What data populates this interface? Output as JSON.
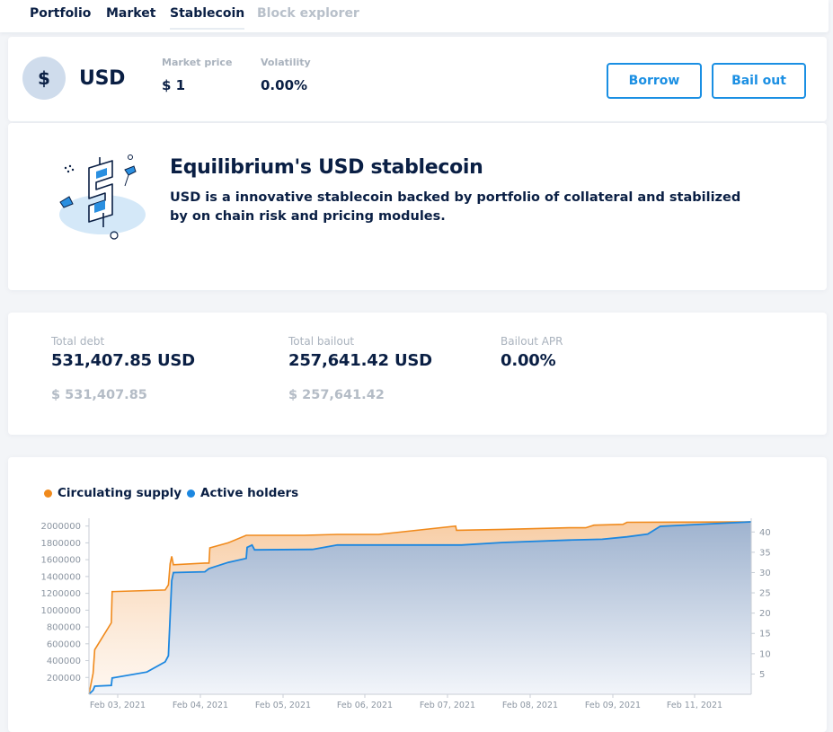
{
  "nav": {
    "tabs": [
      {
        "label": "Portfolio"
      },
      {
        "label": "Market"
      },
      {
        "label": "Stablecoin"
      },
      {
        "label": "Block explorer"
      }
    ]
  },
  "header": {
    "coin_symbol": "$",
    "coin_name": "USD",
    "market_price_label": "Market price",
    "market_price_value": "$ 1",
    "volatility_label": "Volatility",
    "volatility_value": "0.00%",
    "borrow_label": "Borrow",
    "bailout_label": "Bail out"
  },
  "intro": {
    "title": "Equilibrium's USD stablecoin",
    "text": "USD is a innovative stablecoin backed by portfolio of collateral and stabilized by on chain risk and pricing modules."
  },
  "stats": {
    "total_debt_label": "Total debt",
    "total_debt_value": "531,407.85 USD",
    "total_debt_usd": "$ 531,407.85",
    "total_bailout_label": "Total bailout",
    "total_bailout_value": "257,641.42 USD",
    "total_bailout_usd": "$ 257,641.42",
    "bailout_apr_label": "Bailout APR",
    "bailout_apr_value": "0.00%"
  },
  "colors": {
    "accent": "#1a8fe3",
    "supply": "#f08a1c",
    "holders": "#1c87e0"
  },
  "chart_data": {
    "type": "area",
    "legend": [
      "Circulating supply",
      "Active holders"
    ],
    "x_ticks": [
      "Feb 03, 2021",
      "Feb 04, 2021",
      "Feb 05, 2021",
      "Feb 06, 2021",
      "Feb 07, 2021",
      "Feb 08, 2021",
      "Feb 09, 2021",
      "Feb 11, 2021"
    ],
    "y_left_ticks": [
      200000,
      400000,
      600000,
      800000,
      1000000,
      1200000,
      1400000,
      1600000,
      1800000,
      2000000
    ],
    "y_left_ticks_text": [
      "200000",
      "400000",
      "600000",
      "800000",
      "1000000",
      "1200000",
      "1400000",
      "1600000",
      "1800000",
      "2000000"
    ],
    "y_right_ticks": [
      5,
      10,
      15,
      20,
      25,
      30,
      35,
      40
    ],
    "y_right_ticks_text": [
      "5",
      "10",
      "15",
      "20",
      "25",
      "30",
      "35",
      "40"
    ],
    "ylim_left": [
      0,
      2050000
    ],
    "ylim_right": [
      0,
      42.5
    ],
    "xlim": [
      0,
      8
    ],
    "series": [
      {
        "name": "Circulating supply",
        "axis": "left",
        "points": [
          [
            0,
            0
          ],
          [
            0.05,
            250000
          ],
          [
            0.07,
            530000
          ],
          [
            0.27,
            850000
          ],
          [
            0.28,
            1220000
          ],
          [
            0.92,
            1240000
          ],
          [
            0.96,
            1300000
          ],
          [
            0.98,
            1550000
          ],
          [
            1.0,
            1640000
          ],
          [
            1.02,
            1540000
          ],
          [
            1.4,
            1560000
          ],
          [
            1.45,
            1560000
          ],
          [
            1.46,
            1740000
          ],
          [
            1.68,
            1800000
          ],
          [
            1.9,
            1890000
          ],
          [
            2.6,
            1890000
          ],
          [
            3.0,
            1900000
          ],
          [
            3.5,
            1900000
          ],
          [
            4.43,
            2000000
          ],
          [
            4.44,
            1950000
          ],
          [
            5.0,
            1960000
          ],
          [
            5.8,
            1980000
          ],
          [
            6.0,
            1980000
          ],
          [
            6.1,
            2010000
          ],
          [
            6.45,
            2020000
          ],
          [
            6.5,
            2045000
          ],
          [
            8.0,
            2050000
          ]
        ]
      },
      {
        "name": "Active holders",
        "axis": "right",
        "points": [
          [
            0,
            0
          ],
          [
            0.05,
            1
          ],
          [
            0.07,
            2
          ],
          [
            0.27,
            2.2
          ],
          [
            0.28,
            4
          ],
          [
            0.7,
            5.5
          ],
          [
            0.92,
            8
          ],
          [
            0.96,
            9.5
          ],
          [
            1.0,
            28
          ],
          [
            1.02,
            30
          ],
          [
            1.4,
            30.2
          ],
          [
            1.45,
            31
          ],
          [
            1.68,
            32.5
          ],
          [
            1.9,
            33.5
          ],
          [
            1.91,
            36.2
          ],
          [
            1.97,
            36.8
          ],
          [
            2.0,
            35.6
          ],
          [
            2.7,
            35.7
          ],
          [
            3.0,
            36.8
          ],
          [
            4.4,
            36.8
          ],
          [
            4.5,
            36.8
          ],
          [
            5.0,
            37.4
          ],
          [
            5.8,
            38
          ],
          [
            6.2,
            38.2
          ],
          [
            6.5,
            38.8
          ],
          [
            6.75,
            39.5
          ],
          [
            6.9,
            41.4
          ],
          [
            8.0,
            42.5
          ]
        ]
      }
    ]
  }
}
